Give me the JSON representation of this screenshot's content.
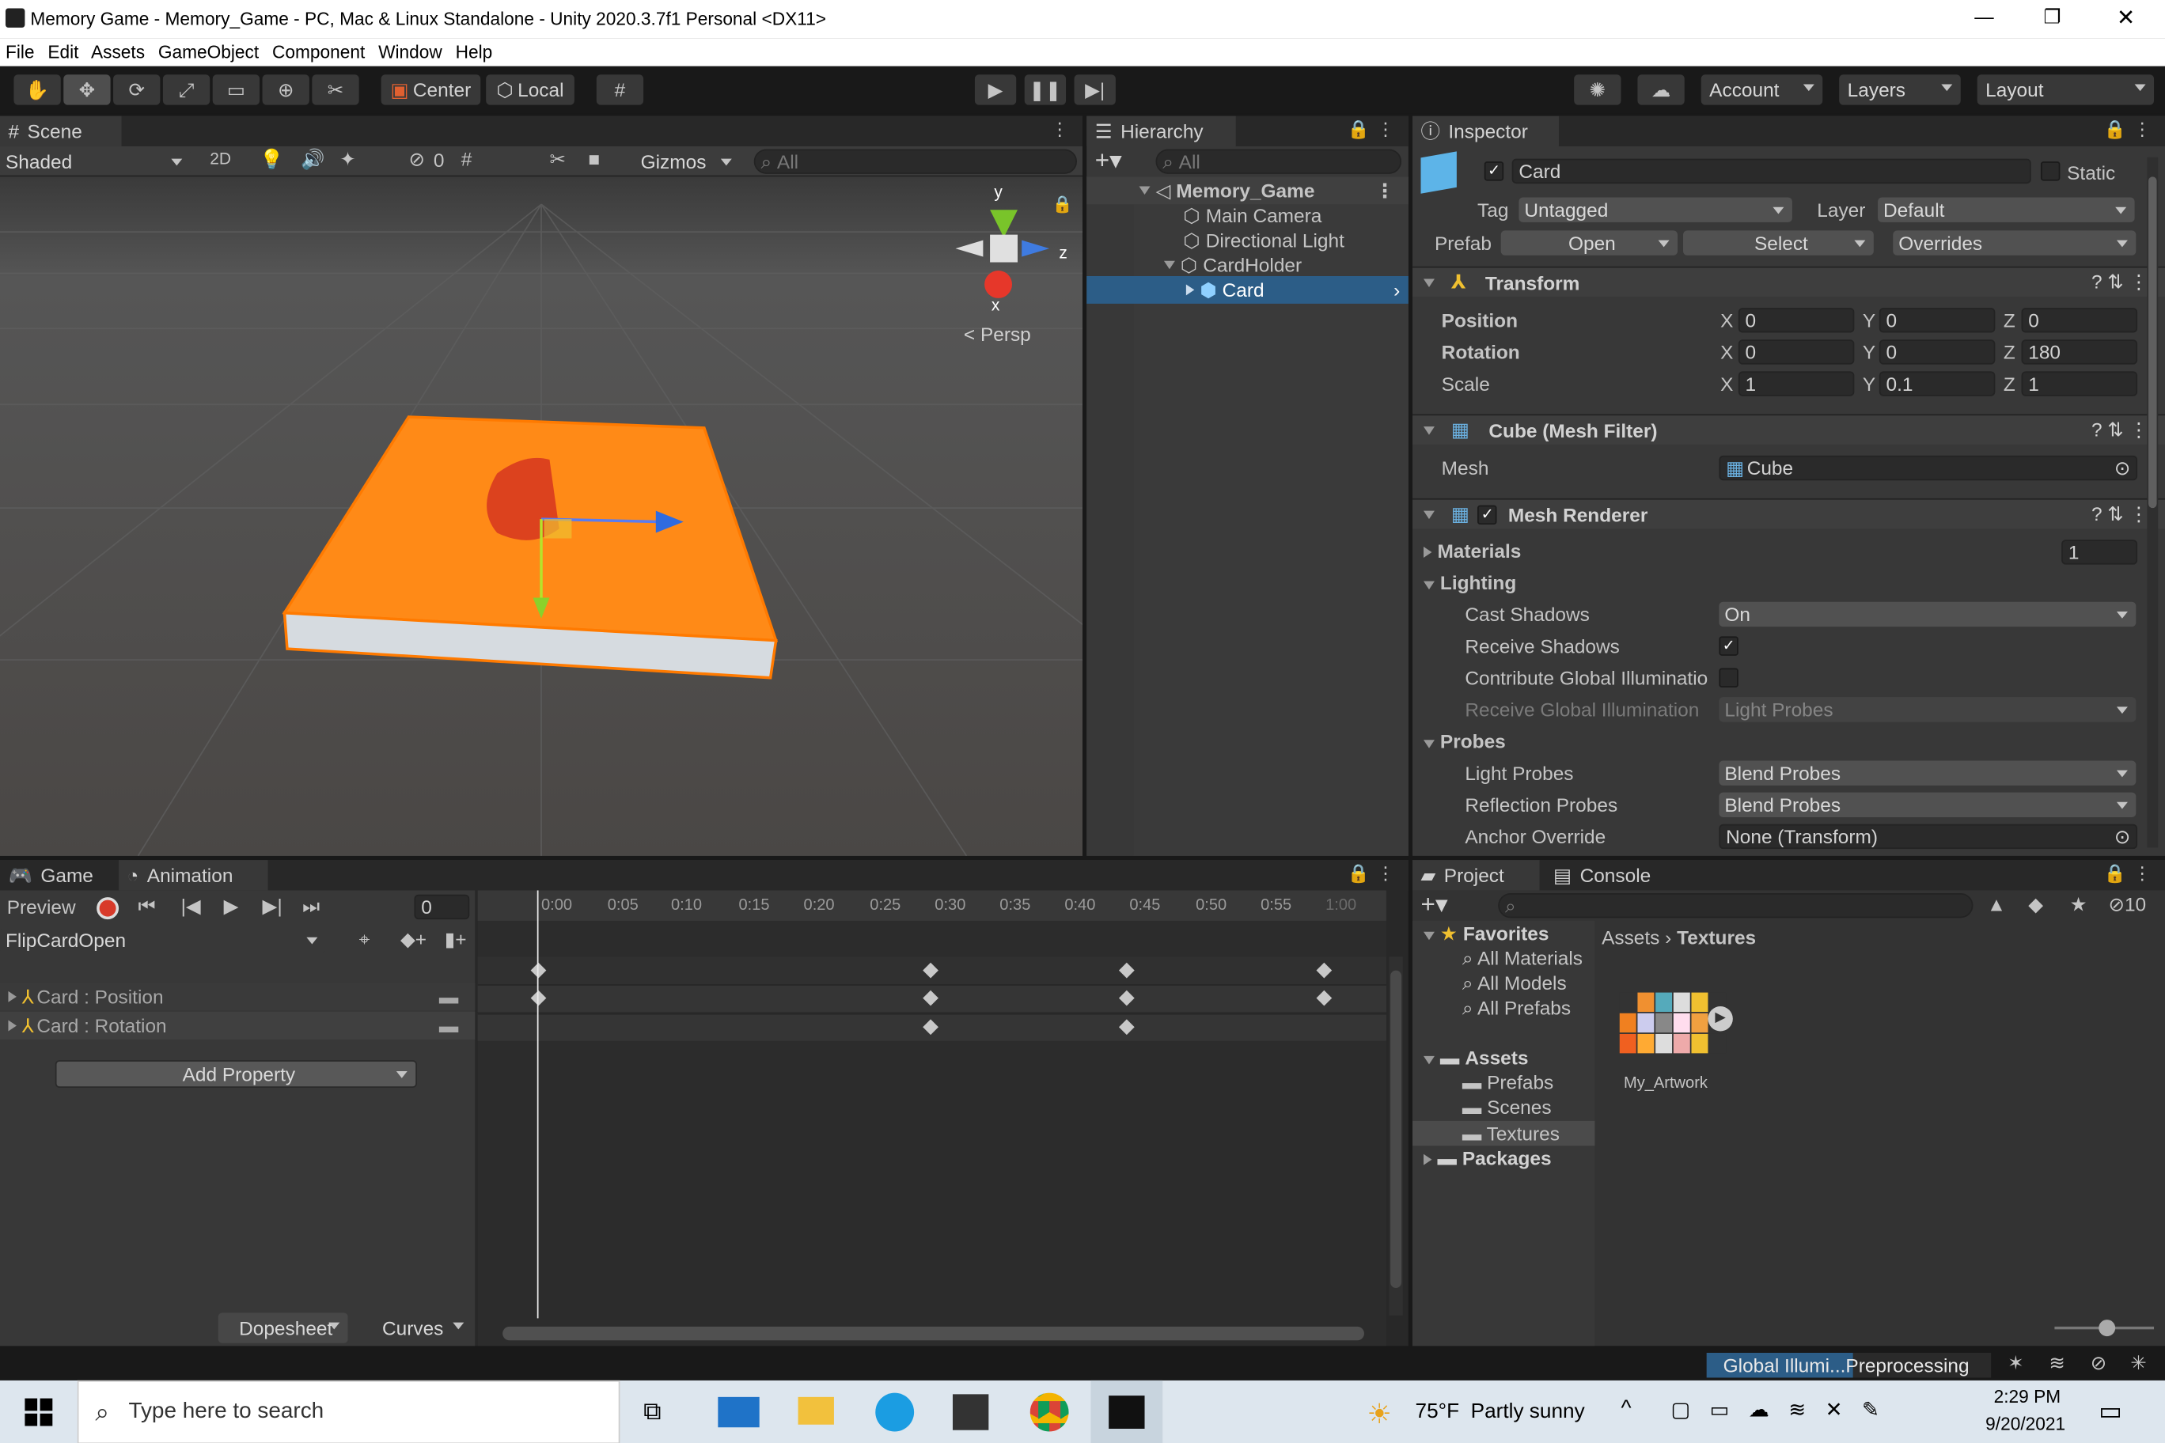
{
  "window": {
    "title": "Memory Game - Memory_Game - PC, Mac & Linux Standalone - Unity 2020.3.7f1 Personal <DX11>",
    "min": "—",
    "max": "❐",
    "close": "✕"
  },
  "menu": [
    "File",
    "Edit",
    "Assets",
    "GameObject",
    "Component",
    "Window",
    "Help"
  ],
  "toolbar": {
    "center": "Center",
    "local": "Local",
    "account": "Account",
    "layers": "Layers",
    "layout": "Layout"
  },
  "scene": {
    "tab": "Scene",
    "shaded": "Shaded",
    "mode2d": "2D",
    "hidden_count": "0",
    "gizmos": "Gizmos",
    "search_placeholder": "All",
    "persp": "Persp",
    "axis_y": "y",
    "axis_x": "x",
    "axis_z": "z"
  },
  "hierarchy": {
    "tab": "Hierarchy",
    "search_placeholder": "All",
    "items": [
      {
        "label": "Memory_Game"
      },
      {
        "label": "Main Camera"
      },
      {
        "label": "Directional Light"
      },
      {
        "label": "CardHolder"
      },
      {
        "label": "Card"
      }
    ]
  },
  "inspector": {
    "tab": "Inspector",
    "name": "Card",
    "static": "Static",
    "tag_label": "Tag",
    "tag": "Untagged",
    "layer_label": "Layer",
    "layer": "Default",
    "prefab_label": "Prefab",
    "open": "Open",
    "select": "Select",
    "overrides": "Overrides",
    "transform": {
      "title": "Transform",
      "position": "Position",
      "rotation": "Rotation",
      "scale": "Scale",
      "pos": [
        "0",
        "0",
        "0"
      ],
      "rot": [
        "0",
        "0",
        "180"
      ],
      "scl": [
        "1",
        "0.1",
        "1"
      ],
      "x": "X",
      "y": "Y",
      "z": "Z"
    },
    "meshfilter": {
      "title": "Cube (Mesh Filter)",
      "mesh_label": "Mesh",
      "mesh": "Cube"
    },
    "renderer": {
      "title": "Mesh Renderer",
      "materials": "Materials",
      "materials_count": "1",
      "lighting": "Lighting",
      "cast_shadows": "Cast Shadows",
      "cast_value": "On",
      "receive_shadows": "Receive Shadows",
      "contribute_gi": "Contribute Global Illuminatio",
      "receive_gi": "Receive Global Illumination",
      "receive_gi_value": "Light Probes",
      "probes": "Probes",
      "light_probes": "Light Probes",
      "light_probes_value": "Blend Probes",
      "reflection_probes": "Reflection Probes",
      "reflection_value": "Blend Probes",
      "anchor": "Anchor Override",
      "anchor_value": "None (Transform)"
    }
  },
  "animation": {
    "game_tab": "Game",
    "anim_tab": "Animation",
    "preview": "Preview",
    "frame": "0",
    "clip": "FlipCardOpen",
    "props": [
      "Card : Position",
      "Card : Rotation"
    ],
    "add_property": "Add Property",
    "dopesheet": "Dopesheet",
    "curves": "Curves",
    "ticks": [
      "0:00",
      "0:05",
      "0:10",
      "0:15",
      "0:20",
      "0:25",
      "0:30",
      "0:35",
      "0:40",
      "0:45",
      "0:50",
      "0:55",
      "1:00"
    ]
  },
  "project": {
    "tab": "Project",
    "console_tab": "Console",
    "favorites": "Favorites",
    "fav_items": [
      "All Materials",
      "All Models",
      "All Prefabs"
    ],
    "assets": "Assets",
    "asset_items": [
      "Prefabs",
      "Scenes",
      "Textures"
    ],
    "packages": "Packages",
    "breadcrumb_root": "Assets",
    "breadcrumb_current": "Textures",
    "asset_name": "My_Artwork",
    "hidden_count": "10"
  },
  "status": {
    "gi": "Global Illumi...Preprocessing"
  },
  "taskbar": {
    "search": "Type here to search",
    "weather": "75°F  Partly sunny",
    "time": "2:29 PM",
    "date": "9/20/2021"
  }
}
